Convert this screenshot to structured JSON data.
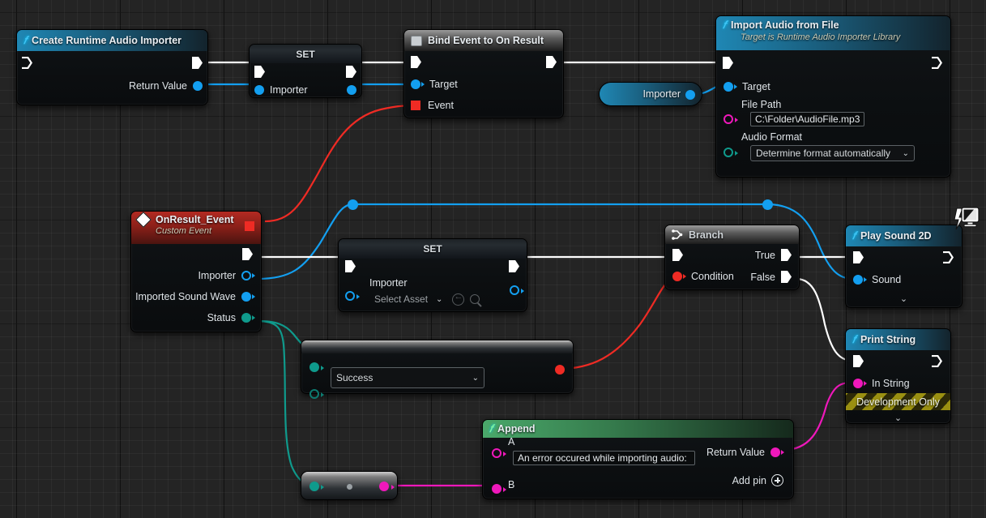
{
  "app": {
    "editor": "Unreal Engine Blueprint Graph"
  },
  "nodes": {
    "create_importer": {
      "title": "Create Runtime Audio Importer",
      "icon": "function-icon",
      "out_pins": [
        {
          "label": "Return Value",
          "type": "object",
          "color": "#139ff0"
        }
      ]
    },
    "set_importer_1": {
      "title": "SET",
      "pin_label": "Importer"
    },
    "bind_event": {
      "title": "Bind Event to On Result",
      "icon": "bind-event-icon",
      "pins": [
        {
          "label": "Target",
          "color": "#139ff0"
        },
        {
          "label": "Event",
          "color": "#ef2b24"
        }
      ]
    },
    "importer_getter": {
      "title": "Importer"
    },
    "import_audio": {
      "title": "Import Audio from File",
      "subtitle": "Target is Runtime Audio Importer Library",
      "icon": "function-icon",
      "pins": [
        {
          "label": "Target",
          "color": "#139ff0"
        },
        {
          "label": "File Path",
          "color": "#ef18bb"
        },
        {
          "label": "Audio Format",
          "color": "#0f9a8c"
        }
      ],
      "file_path_value": "C:\\Folder\\AudioFile.mp3",
      "audio_format_value": "Determine format automatically"
    },
    "on_result_event": {
      "title": "OnResult_Event",
      "subtitle": "Custom Event",
      "icon": "custom-event-icon",
      "out_pins": [
        {
          "label": "Importer",
          "color": "#139ff0"
        },
        {
          "label": "Imported Sound Wave",
          "color": "#139ff0"
        },
        {
          "label": "Status",
          "color": "#0f9a8c"
        }
      ]
    },
    "set_importer_2": {
      "title": "SET",
      "pin_label": "Importer",
      "asset_placeholder": "Select Asset"
    },
    "equal_enum": {
      "title": "",
      "enum_value": "Success"
    },
    "enum_to_string": {
      "title": ""
    },
    "branch": {
      "title": "Branch",
      "icon": "branch-icon",
      "in_pins": [
        {
          "label": "Condition",
          "color": "#ef2b24"
        }
      ],
      "out_pins": [
        {
          "label": "True"
        },
        {
          "label": "False"
        }
      ]
    },
    "play_sound_2d": {
      "title": "Play Sound 2D",
      "icon": "function-icon",
      "badge": "client-only-icon",
      "pins": [
        {
          "label": "Sound",
          "color": "#139ff0"
        }
      ]
    },
    "print_string": {
      "title": "Print String",
      "icon": "function-icon",
      "pins": [
        {
          "label": "In String",
          "color": "#ef18bb"
        }
      ],
      "banner": "Development Only"
    },
    "append": {
      "title": "Append",
      "icon": "function-icon",
      "in_pins": [
        {
          "label": "A",
          "color": "#ef18bb"
        },
        {
          "label": "B",
          "color": "#ef18bb"
        }
      ],
      "a_value": "An error occured while importing audio: ",
      "out_pins": [
        {
          "label": "Return Value",
          "color": "#ef18bb"
        }
      ],
      "add_pin_label": "Add pin"
    }
  },
  "colors": {
    "exec_wire": "#ffffff",
    "object_wire": "#139ff0",
    "delegate_wire": "#ef2b24",
    "string_wire": "#ef18bb",
    "enum_wire": "#0f9a8c",
    "bool_wire": "#ef2b24",
    "grid_bg": "#242424"
  }
}
